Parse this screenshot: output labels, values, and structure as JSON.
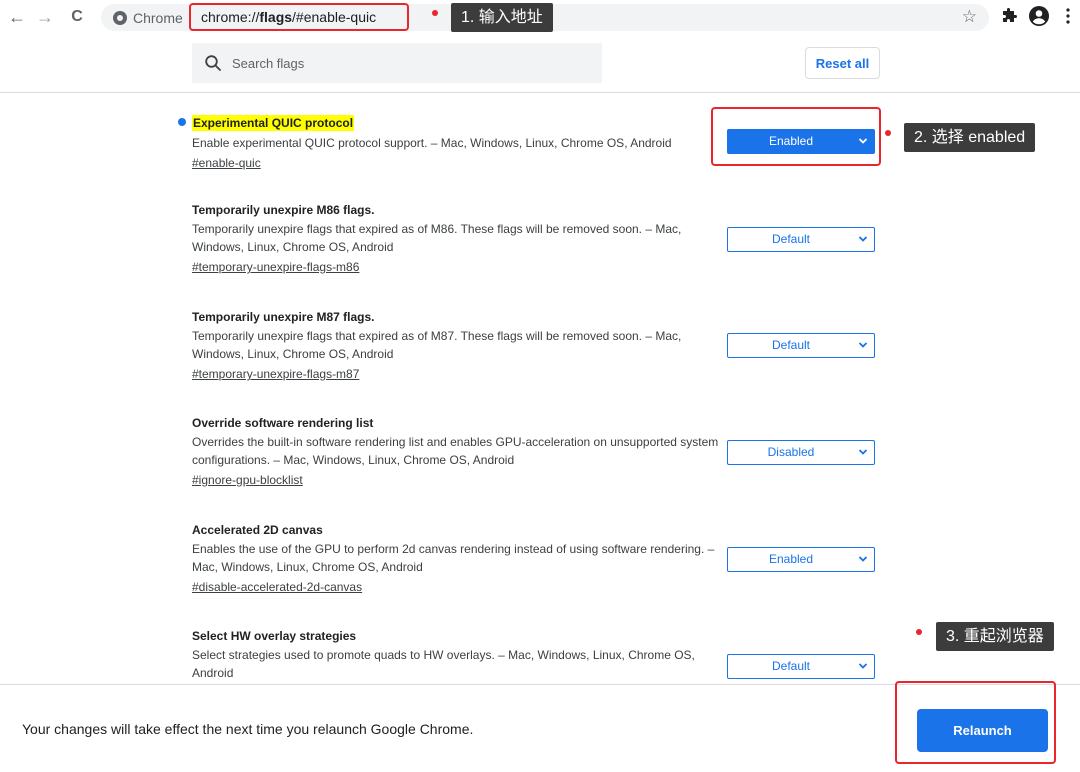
{
  "toolbar": {
    "back_glyph": "←",
    "forward_glyph": "→",
    "reload_glyph": "C",
    "chip_label": "Chrome",
    "url_prefix": "chrome://",
    "url_bold": "flags",
    "url_suffix": "/#enable-quic",
    "star_glyph": "☆",
    "icons": [
      "back-icon",
      "forward-icon",
      "reload-icon",
      "chrome-icon",
      "bookmark-star-icon",
      "extensions-icon",
      "profile-icon",
      "menu-icon"
    ]
  },
  "annotations": {
    "step1": "1. 输入地址",
    "step2": "2. 选择 enabled",
    "step3": "3. 重起浏览器",
    "accent_color": "#e8262c"
  },
  "header": {
    "search_placeholder": "Search flags",
    "reset_label": "Reset all"
  },
  "flags": [
    {
      "title": "Experimental QUIC protocol",
      "desc": "Enable experimental QUIC protocol support. – Mac, Windows, Linux, Chrome OS, Android",
      "link": "#enable-quic",
      "value": "Enabled",
      "modified": true
    },
    {
      "title": "Temporarily unexpire M86 flags.",
      "desc": "Temporarily unexpire flags that expired as of M86. These flags will be removed soon. – Mac, Windows, Linux, Chrome OS, Android",
      "link": "#temporary-unexpire-flags-m86",
      "value": "Default"
    },
    {
      "title": "Temporarily unexpire M87 flags.",
      "desc": "Temporarily unexpire flags that expired as of M87. These flags will be removed soon. – Mac, Windows, Linux, Chrome OS, Android",
      "link": "#temporary-unexpire-flags-m87",
      "value": "Default"
    },
    {
      "title": "Override software rendering list",
      "desc": "Overrides the built-in software rendering list and enables GPU-acceleration on unsupported system configurations. – Mac, Windows, Linux, Chrome OS, Android",
      "link": "#ignore-gpu-blocklist",
      "value": "Disabled"
    },
    {
      "title": "Accelerated 2D canvas",
      "desc": "Enables the use of the GPU to perform 2d canvas rendering instead of using software rendering. – Mac, Windows, Linux, Chrome OS, Android",
      "link": "#disable-accelerated-2d-canvas",
      "value": "Enabled"
    },
    {
      "title": "Select HW overlay strategies",
      "desc": "Select strategies used to promote quads to HW overlays. – Mac, Windows, Linux, Chrome OS, Android",
      "link": "",
      "value": "Default"
    }
  ],
  "footer": {
    "message": "Your changes will take effect the next time you relaunch Google Chrome.",
    "relaunch_label": "Relaunch"
  },
  "colors": {
    "accent": "#1a73e8",
    "highlight": "#ffff00"
  }
}
